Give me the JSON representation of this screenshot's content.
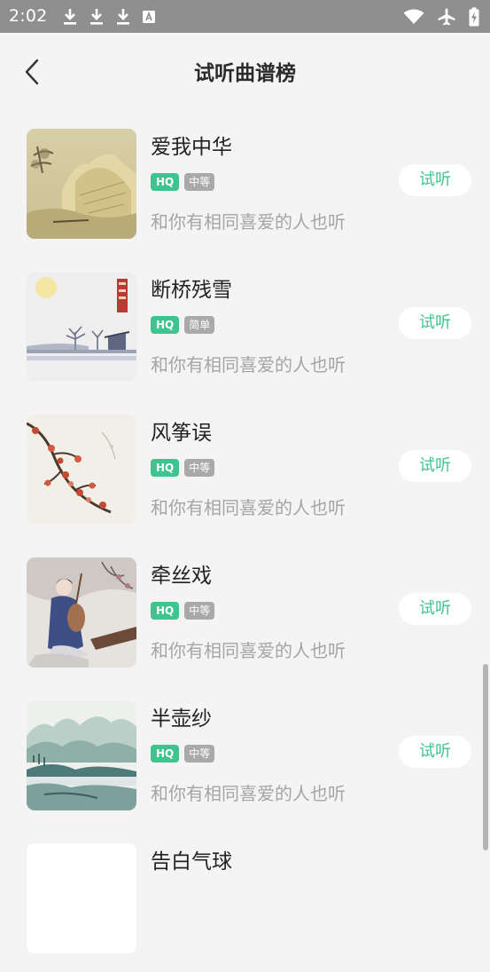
{
  "status_bar": {
    "time": "2:02",
    "left_icons": [
      "download-icon",
      "download-icon",
      "download-icon",
      "keyboard-a-icon"
    ],
    "right_icons": [
      "wifi-icon",
      "airplane-icon",
      "battery-charging-icon"
    ]
  },
  "header": {
    "title": "试听曲谱榜",
    "back_icon": "chevron-left-icon"
  },
  "songs": [
    {
      "title": "爱我中华",
      "hq": "HQ",
      "level": "中等",
      "desc": "和你有相同喜爱的人也听",
      "button": "试听",
      "cover": "landscape-painting"
    },
    {
      "title": "断桥残雪",
      "hq": "HQ",
      "level": "简单",
      "desc": "和你有相同喜爱的人也听",
      "button": "试听",
      "cover": "winter-lake-painting"
    },
    {
      "title": "风筝误",
      "hq": "HQ",
      "level": "中等",
      "desc": "和你有相同喜爱的人也听",
      "button": "试听",
      "cover": "plum-blossom-painting"
    },
    {
      "title": "牵丝戏",
      "hq": "HQ",
      "level": "中等",
      "desc": "和你有相同喜爱的人也听",
      "button": "试听",
      "cover": "pipa-lady-painting"
    },
    {
      "title": "半壶纱",
      "hq": "HQ",
      "level": "中等",
      "desc": "和你有相同喜爱的人也听",
      "button": "试听",
      "cover": "mountain-river-painting"
    },
    {
      "title": "告白气球",
      "cover": "blank"
    }
  ],
  "colors": {
    "accent": "#3ec48f",
    "level_tag": "#a9a9a9",
    "status_bar": "#8f8f8f",
    "background": "#f4f4f4"
  }
}
